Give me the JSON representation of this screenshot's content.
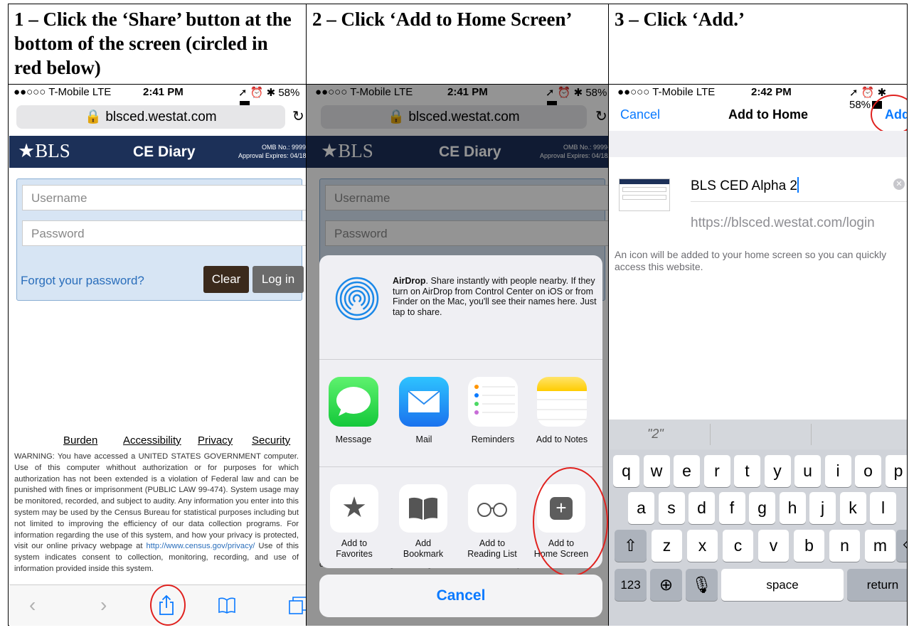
{
  "steps": [
    {
      "header": "1 – Click the ‘Share’ button at the bottom of the screen (circled in red below)"
    },
    {
      "header": "2 – Click ‘Add to Home Screen’"
    },
    {
      "header": "3 – Click ‘Add.’"
    }
  ],
  "status": {
    "carrier": "●●○○○ T-Mobile  LTE",
    "time1": "2:41 PM",
    "time2": "2:41 PM",
    "time3": "2:42 PM",
    "battery": "58%"
  },
  "safari": {
    "url": "blsced.westat.com"
  },
  "site": {
    "logo": "BLS",
    "title": "CE Diary",
    "omb_line1": "OMB No.: 9999-",
    "omb_line2": "Approval Expires: 04/18/",
    "username_placeholder": "Username",
    "password_placeholder": "Password",
    "forgot": "Forgot your password?",
    "clear": "Clear",
    "login": "Log in",
    "footer_links": [
      "Burden",
      "Accessibility",
      "Privacy",
      "Security"
    ],
    "warning_pre": "WARNING: You have accessed a UNITED STATES GOVERNMENT computer. Use of this computer whithout authorization or for purposes for which authorization has not been extended is a violation of Federal law and can be punished with fines or imprisonment (PUBLIC LAW 99-474). System usage may be monitored, recorded, and subject to audity. Any information you enter into this system may be used by the Census Bureau for statistical purposes including but not limited to improving the efficiency of our data collection programs. For information regarding the use of this system, and how your privacy is protected, visit our online privacy webpage at",
    "warning_link": "http://www.census.gov/privacy/",
    "warning_post": "Use of this system indicates consent to collection, monitoring, recording, and use of information provided inside this system.",
    "warning_tail": "collection, monitoring, recording, and use of information provided inside t"
  },
  "share": {
    "airdrop_bold": "AirDrop",
    "airdrop_text": ". Share instantly with people nearby. If they turn on AirDrop from Control Center on iOS or from Finder on the Mac, you'll see their names here. Just tap to share.",
    "apps": [
      "Message",
      "Mail",
      "Reminders",
      "Add to Notes"
    ],
    "actions": [
      {
        "l1": "Add to",
        "l2": "Favorites"
      },
      {
        "l1": "Add",
        "l2": "Bookmark"
      },
      {
        "l1": "Add to",
        "l2": "Reading List"
      },
      {
        "l1": "Add to",
        "l2": "Home Screen"
      }
    ],
    "cancel": "Cancel"
  },
  "add_home": {
    "cancel": "Cancel",
    "title": "Add to Home",
    "add": "Add",
    "name": "BLS CED Alpha 2",
    "url": "https://blsced.westat.com/login",
    "description": "An icon will be added to your home screen so you can quickly access this website.",
    "suggestion": "\"2\""
  },
  "keyboard": {
    "row1": [
      "q",
      "w",
      "e",
      "r",
      "t",
      "y",
      "u",
      "i",
      "o",
      "p"
    ],
    "row2": [
      "a",
      "s",
      "d",
      "f",
      "g",
      "h",
      "j",
      "k",
      "l"
    ],
    "row3": [
      "z",
      "x",
      "c",
      "v",
      "b",
      "n",
      "m"
    ],
    "numbers": "123",
    "space": "space",
    "return": "return"
  },
  "colors": {
    "accent_red": "#e0221f",
    "ios_blue": "#0a7aff",
    "bls_navy": "#1c3058"
  }
}
